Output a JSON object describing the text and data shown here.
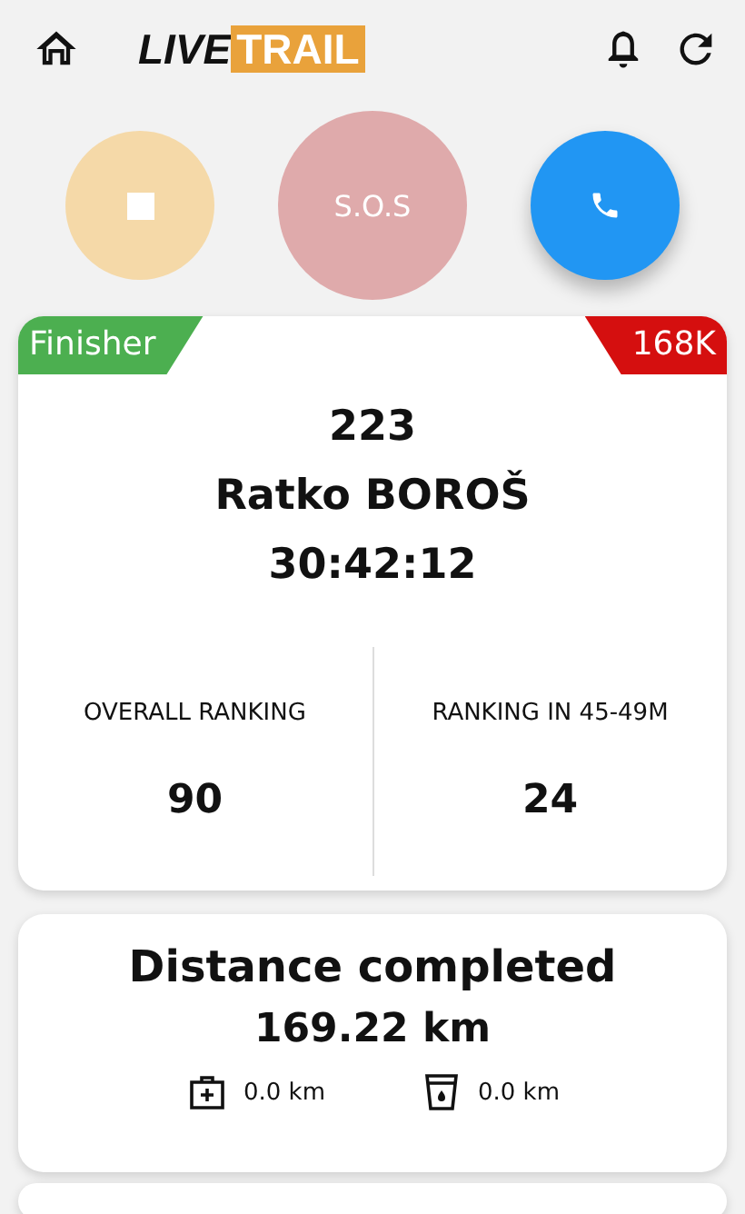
{
  "header": {
    "logo": {
      "part_1": "LIVE",
      "part_2": "TRAIL"
    }
  },
  "actions": {
    "sos": "S.O.S"
  },
  "runner": {
    "status": "Finisher",
    "race": "168K",
    "bib": "223",
    "name": "Ratko BOROŠ",
    "time": "30:42:12",
    "rankings": [
      {
        "label": "OVERALL RANKING",
        "value": "90"
      },
      {
        "label": "RANKING IN 45-49M",
        "value": "24"
      }
    ]
  },
  "distance": {
    "title": "Distance completed",
    "value": "169.22 km",
    "items": [
      {
        "kind": "medical",
        "value": "0.0 km"
      },
      {
        "kind": "water",
        "value": "0.0 km"
      }
    ]
  }
}
